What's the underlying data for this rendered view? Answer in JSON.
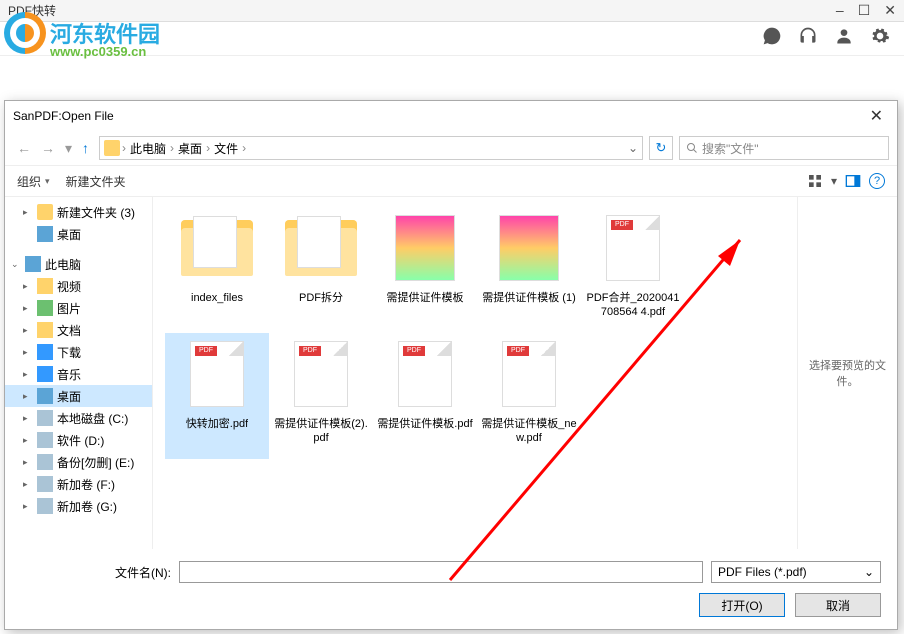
{
  "app": {
    "title": "PDF快转",
    "wincontrols": {
      "min": "–",
      "max": "☐",
      "close": "✕"
    }
  },
  "watermark": {
    "text": "河东软件园",
    "url": "www.pc0359.cn"
  },
  "dialog": {
    "title": "SanPDF:Open File",
    "close": "✕",
    "nav": {
      "back": "←",
      "fwd": "→",
      "dropdown": "▾",
      "up": "↑"
    },
    "breadcrumb": {
      "p1": "此电脑",
      "p2": "桌面",
      "p3": "文件",
      "sep": "›",
      "dropdown": "⌄",
      "refresh": "↻"
    },
    "search": {
      "placeholder": "搜索\"文件\""
    },
    "toolbar": {
      "organize": "组织",
      "newfolder": "新建文件夹",
      "drop": "▾",
      "help": "?"
    },
    "tree": [
      {
        "label": "新建文件夹 (3)",
        "icon": "ico-folder",
        "caret": "▸",
        "indent": 1
      },
      {
        "label": "桌面",
        "icon": "ico-desktop",
        "caret": "",
        "indent": 1
      },
      {
        "label": "",
        "icon": "",
        "caret": "",
        "indent": 0,
        "spacer": true
      },
      {
        "label": "此电脑",
        "icon": "ico-pc",
        "caret": "⌄",
        "indent": 0
      },
      {
        "label": "视频",
        "icon": "ico-vid",
        "caret": "▸",
        "indent": 1
      },
      {
        "label": "图片",
        "icon": "ico-pic",
        "caret": "▸",
        "indent": 1
      },
      {
        "label": "文档",
        "icon": "ico-doc",
        "caret": "▸",
        "indent": 1
      },
      {
        "label": "下载",
        "icon": "ico-dl",
        "caret": "▸",
        "indent": 1
      },
      {
        "label": "音乐",
        "icon": "ico-music",
        "caret": "▸",
        "indent": 1
      },
      {
        "label": "桌面",
        "icon": "ico-desktop",
        "caret": "▸",
        "indent": 1,
        "selected": true
      },
      {
        "label": "本地磁盘 (C:)",
        "icon": "ico-drive",
        "caret": "▸",
        "indent": 1
      },
      {
        "label": "软件 (D:)",
        "icon": "ico-drive",
        "caret": "▸",
        "indent": 1
      },
      {
        "label": "备份[勿删] (E:)",
        "icon": "ico-drive",
        "caret": "▸",
        "indent": 1
      },
      {
        "label": "新加卷 (F:)",
        "icon": "ico-drive",
        "caret": "▸",
        "indent": 1
      },
      {
        "label": "新加卷 (G:)",
        "icon": "ico-drive",
        "caret": "▸",
        "indent": 1
      }
    ],
    "files": [
      {
        "name": "index_files",
        "type": "folder"
      },
      {
        "name": "PDF拆分",
        "type": "folder"
      },
      {
        "name": "需提供证件模板",
        "type": "img"
      },
      {
        "name": "需提供证件模板 (1)",
        "type": "img"
      },
      {
        "name": "PDF合并_2020041708564 4.pdf",
        "type": "pdf"
      },
      {
        "name": "快转加密.pdf",
        "type": "pdf",
        "selected": true
      },
      {
        "name": "需提供证件模板(2).pdf",
        "type": "pdf"
      },
      {
        "name": "需提供证件模板.pdf",
        "type": "pdf"
      },
      {
        "name": "需提供证件模板_new.pdf",
        "type": "pdf"
      }
    ],
    "preview_text": "选择要预览的文件。",
    "filename_label": "文件名(N):",
    "filename_value": "",
    "filetype": "PDF Files (*.pdf)",
    "filetype_drop": "⌄",
    "open_btn": "打开(O)",
    "cancel_btn": "取消"
  }
}
